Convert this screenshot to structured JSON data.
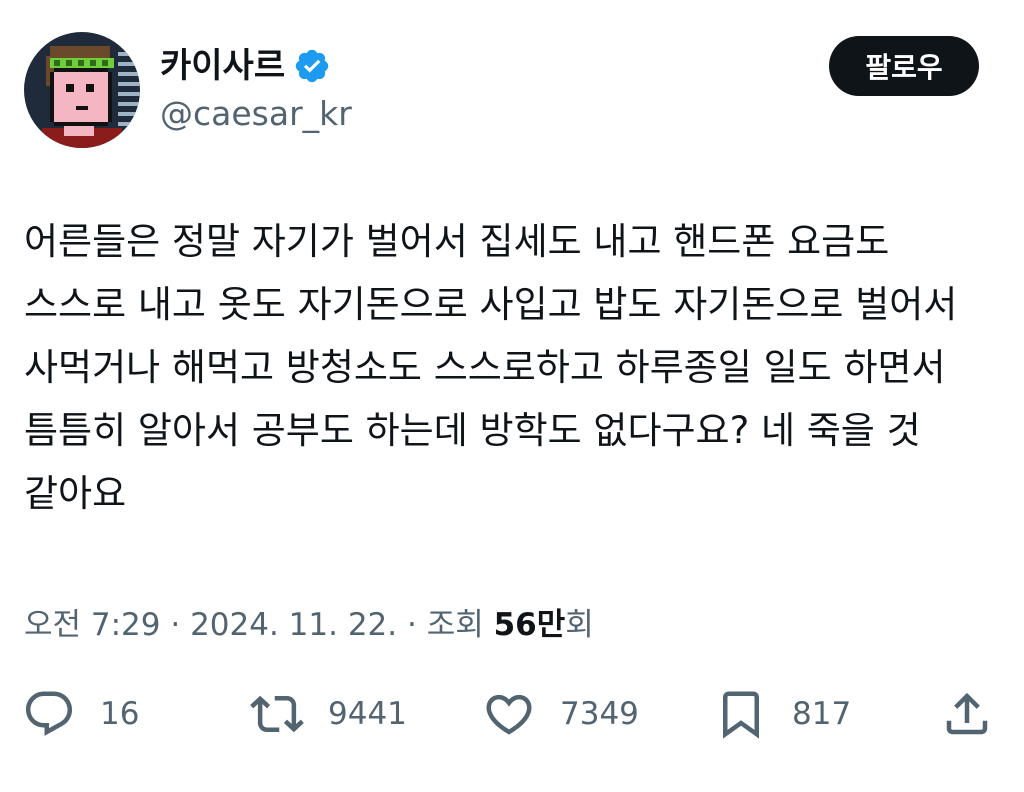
{
  "author": {
    "display_name": "카이사르",
    "handle": "@caesar_kr",
    "verified_icon": "verified-badge-icon",
    "avatar": "pixel-art-avatar"
  },
  "follow_button": {
    "label": "팔로우"
  },
  "tweet": {
    "text": "어른들은 정말 자기가 벌어서 집세도 내고 핸드폰 요금도 스스로 내고 옷도 자기돈으로 사입고 밥도 자기돈으로 벌어서 사먹거나 해먹고 방청소도 스스로하고 하루종일 일도 하면서 틈틈히 알아서 공부도 하는데 방학도 없다구요? 네 죽을 것 같아요"
  },
  "meta": {
    "time": "오전 7:29",
    "separator1": " · ",
    "date": "2024. 11. 22.",
    "separator2": " · ",
    "views_label": "조회 ",
    "views_number": "56만",
    "views_suffix": "회"
  },
  "actions": {
    "reply": {
      "icon": "reply-icon",
      "count": "16"
    },
    "retweet": {
      "icon": "retweet-icon",
      "count": "9441"
    },
    "like": {
      "icon": "heart-icon",
      "count": "7349"
    },
    "bookmark": {
      "icon": "bookmark-icon",
      "count": "817"
    },
    "share": {
      "icon": "share-icon"
    }
  },
  "colors": {
    "text_primary": "#0f1419",
    "text_secondary": "#536471",
    "verified_blue": "#1d9bf0",
    "button_bg": "#0f1419"
  }
}
